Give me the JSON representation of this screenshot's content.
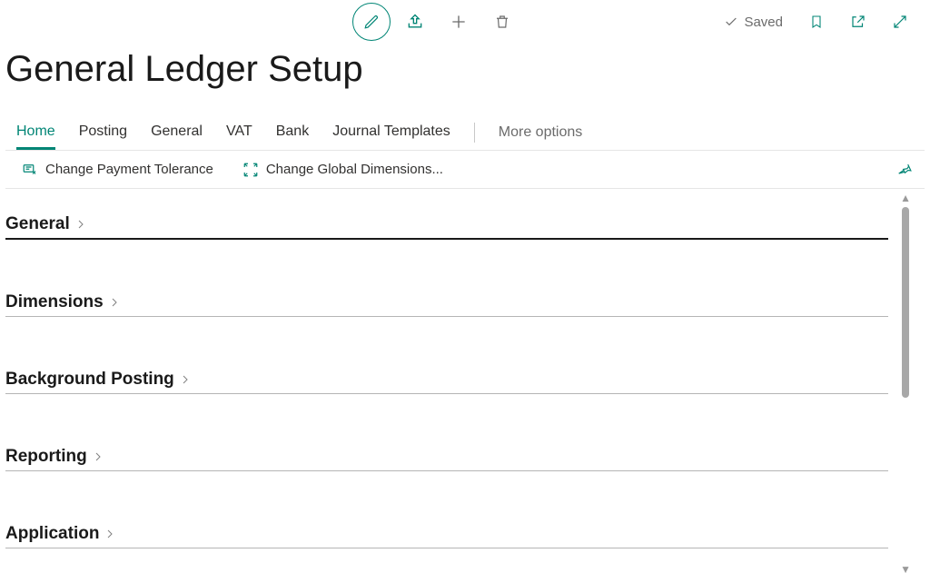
{
  "header": {
    "saved_label": "Saved"
  },
  "page": {
    "title": "General Ledger Setup"
  },
  "tabs": {
    "items": [
      {
        "label": "Home",
        "active": true
      },
      {
        "label": "Posting",
        "active": false
      },
      {
        "label": "General",
        "active": false
      },
      {
        "label": "VAT",
        "active": false
      },
      {
        "label": "Bank",
        "active": false
      },
      {
        "label": "Journal Templates",
        "active": false
      }
    ],
    "more_label": "More options"
  },
  "actions": {
    "items": [
      {
        "label": "Change Payment Tolerance"
      },
      {
        "label": "Change Global Dimensions..."
      }
    ]
  },
  "sections": [
    {
      "label": "General"
    },
    {
      "label": "Dimensions"
    },
    {
      "label": "Background Posting"
    },
    {
      "label": "Reporting"
    },
    {
      "label": "Application"
    }
  ]
}
